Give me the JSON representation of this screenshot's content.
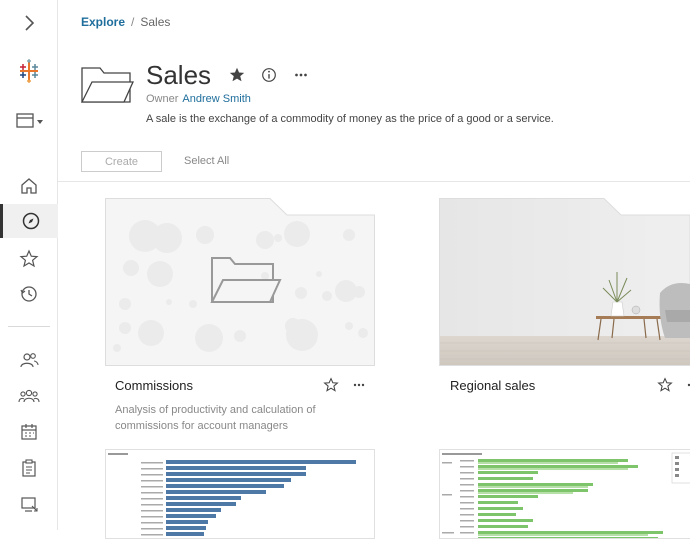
{
  "sidebar": {
    "items": [
      {
        "name": "expand",
        "icon": "chevron-right-icon"
      },
      {
        "name": "logo",
        "icon": "tableau-logo-icon"
      },
      {
        "name": "site-switcher",
        "icon": "site-switcher-icon"
      },
      {
        "name": "home",
        "icon": "home-icon"
      },
      {
        "name": "explore",
        "icon": "compass-icon"
      },
      {
        "name": "favorites",
        "icon": "star-icon"
      },
      {
        "name": "recents",
        "icon": "history-icon"
      },
      {
        "name": "users",
        "icon": "users-icon"
      },
      {
        "name": "groups",
        "icon": "groups-icon"
      },
      {
        "name": "schedules",
        "icon": "calendar-icon"
      },
      {
        "name": "tasks",
        "icon": "clipboard-icon"
      },
      {
        "name": "jobs",
        "icon": "monitor-icon"
      }
    ]
  },
  "breadcrumb": {
    "root": "Explore",
    "separator": "/",
    "current": "Sales"
  },
  "project": {
    "title": "Sales",
    "owner_label": "Owner",
    "owner_name": "Andrew Smith",
    "description": "A sale is the exchange of a commodity of money as the price of a good or a service."
  },
  "toolbar": {
    "create_label": "Create",
    "select_all_label": "Select All"
  },
  "cards": [
    {
      "name": "Commissions",
      "description": "Analysis of productivity and calculation of commissions for account managers",
      "thumbnail": "folder-placeholder"
    },
    {
      "name": "Regional sales",
      "description": "",
      "thumbnail": "room-photo"
    }
  ],
  "colors": {
    "accent": "#1f6e9c",
    "bar_blue": "#4e79a7",
    "bar_green": "#7dc46b"
  }
}
